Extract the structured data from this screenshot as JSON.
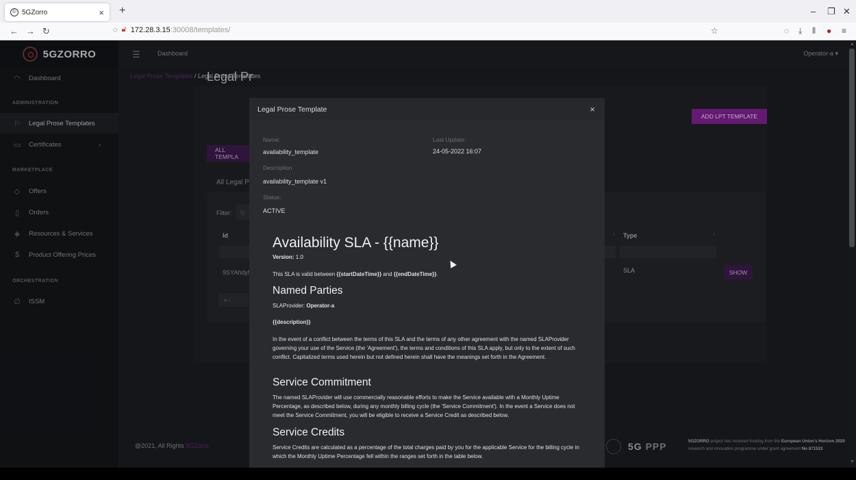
{
  "browser": {
    "tab_title": "5GZorro",
    "url_main": "172.28.3.15",
    "url_rest": ":30008/templates/"
  },
  "app": {
    "brand": "5GZORRO",
    "topbar_title": "Dashboard",
    "operator": "Operator-a",
    "sidebar": {
      "dashboard": "Dashboard",
      "section_admin": "ADMINISTRATION",
      "legal_prose": "Legal Prose Templates",
      "certificates": "Certificates",
      "section_marketplace": "MARKETPLACE",
      "offers": "Offers",
      "orders": "Orders",
      "resources": "Resources & Services",
      "product_prices": "Product Offering Prices",
      "section_orchestration": "ORCHESTRATION",
      "issm": "ISSM"
    },
    "breadcrumb": {
      "parent": "Legal Prose Templates",
      "sep": "/",
      "current": "Legal Prose Templates"
    },
    "page": {
      "title": "Legal Pr",
      "add_button": "ADD LPT TEMPLATE",
      "all_button": "ALL TEMPLA",
      "all_legal": "All Legal P",
      "filter_label": "Filter:",
      "filter_placeholder": "ty",
      "col_id": "Id",
      "col_type": "Type",
      "row_id": "9SYAhdyN",
      "row_type": "SLA",
      "show_button": "SHOW",
      "pager": "«  ‹"
    },
    "footer": {
      "copyright": "@2021, All Rights",
      "brand": "5GZorro",
      "ppp": "PPP",
      "funding_bold1": "5GZORRO",
      "funding_text1": " project has received funding from the ",
      "funding_bold2": "European Union's Horizon 2020",
      "funding_text2": " research and innovation programme under grant agreement ",
      "funding_bold3": "No 871533"
    }
  },
  "modal": {
    "title": "Legal Prose Template",
    "name_label": "Name:",
    "name_value": "availability_template",
    "last_update_label": "Last Update:",
    "last_update_value": "24-05-2022 16:07",
    "description_label": "Description",
    "description_value": "availability_template v1",
    "status_label": "Status:",
    "status_value": "ACTIVE",
    "doc": {
      "heading": "Availability SLA - {{name}}",
      "version_label": "Version:",
      "version_value": " 1.0",
      "valid_pre": "This SLA is valid between ",
      "valid_start": "{{startDateTime}}",
      "valid_mid": " and ",
      "valid_end": "{{endDateTime}}",
      "valid_post": ".",
      "named_parties": "Named Parties",
      "provider_label": "SLAProvider: ",
      "provider_value": "Operator-a",
      "description_token": "{{description}}",
      "conflict_para": "In the event of a conflict between the terms of this SLA and the terms of any other agreement with the named SLAProvider governing your use of the Service (the 'Agreement'), the terms and conditions of this SLA apply, but only to the extent of such conflict. Capitalized terms used herein but not defined herein shall have the meanings set forth in the Agreement.",
      "service_commitment": "Service Commitment",
      "commitment_para": "The named SLAProvider will use commercially reasonable efforts to make the Service available with a Monthly Uptime Percentage, as described below, during any monthly billing cycle (the 'Service Commitment'). In the event a Service does not meet the Service Commitment, you will be eligible to receive a Service Credit as described below.",
      "service_credits": "Service Credits",
      "credits_para": "Service Credits are calculated as a percentage of the total charges paid by you for the applicable Service for the billing cycle in which the Monthly Uptime Percentage fell within the ranges set forth in the table below."
    }
  }
}
